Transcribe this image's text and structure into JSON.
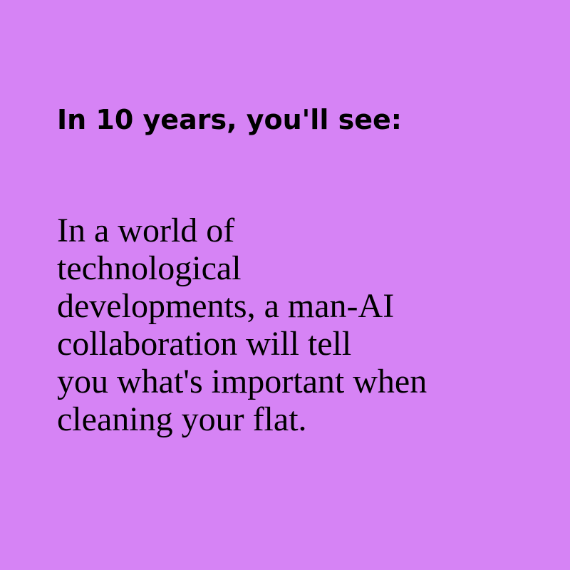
{
  "background_color": "#d683f5",
  "text_color": "#000000",
  "heading": "In 10 years, you'll see:",
  "body_lines": [
    "In a world of",
    "technological",
    "developments, a man-AI",
    "collaboration will tell",
    "you what's important when",
    "cleaning your flat."
  ]
}
